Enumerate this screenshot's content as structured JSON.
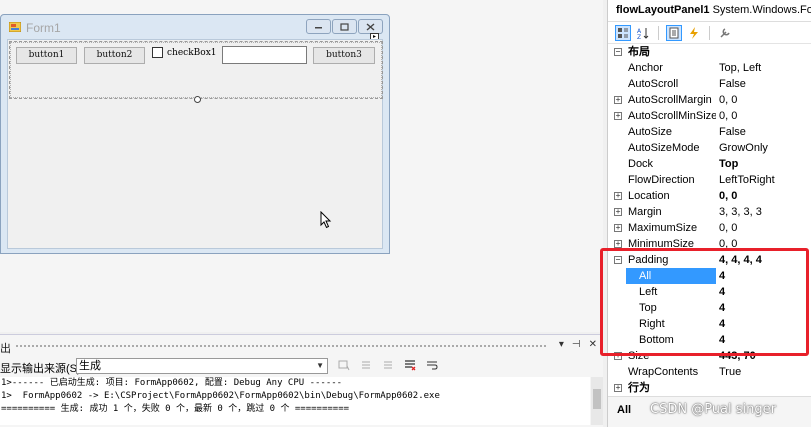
{
  "form": {
    "title": "Form1",
    "buttons": [
      "button1",
      "button2",
      "button3"
    ],
    "checkbox_label": "checkBox1",
    "textbox_value": "",
    "smart_tag": "▸"
  },
  "output": {
    "title": "出",
    "source_label": "显示输出来源(S):",
    "source_value": "生成",
    "lines": [
      "1>------ 已启动生成: 项目: FormApp0602, 配置: Debug Any CPU ------",
      "1>  FormApp0602 -> E:\\CSProject\\FormApp0602\\FormApp0602\\bin\\Debug\\FormApp0602.exe",
      "========== 生成: 成功 1 个，失败 0 个，最新 0 个，跳过 0 个 =========="
    ],
    "header_icons": [
      "▾",
      "⊣",
      "✕"
    ]
  },
  "properties": {
    "object_name": "flowLayoutPanel1",
    "object_type": "System.Windows.Fo",
    "rows": [
      {
        "kind": "category",
        "name": "布局",
        "expander": "⊟"
      },
      {
        "kind": "prop",
        "name": "Anchor",
        "value": "Top, Left"
      },
      {
        "kind": "prop",
        "name": "AutoScroll",
        "value": "False"
      },
      {
        "kind": "prop",
        "name": "AutoScrollMargin",
        "value": "0, 0",
        "expander": "⊞"
      },
      {
        "kind": "prop",
        "name": "AutoScrollMinSize",
        "value": "0, 0",
        "expander": "⊞"
      },
      {
        "kind": "prop",
        "name": "AutoSize",
        "value": "False"
      },
      {
        "kind": "prop",
        "name": "AutoSizeMode",
        "value": "GrowOnly"
      },
      {
        "kind": "prop",
        "name": "Dock",
        "value": "Top",
        "bold": true
      },
      {
        "kind": "prop",
        "name": "FlowDirection",
        "value": "LeftToRight"
      },
      {
        "kind": "prop",
        "name": "Location",
        "value": "0, 0",
        "expander": "⊞",
        "bold": true
      },
      {
        "kind": "prop",
        "name": "Margin",
        "value": "3, 3, 3, 3",
        "expander": "⊞"
      },
      {
        "kind": "prop",
        "name": "MaximumSize",
        "value": "0, 0",
        "expander": "⊞"
      },
      {
        "kind": "prop",
        "name": "MinimumSize",
        "value": "0, 0",
        "expander": "⊞"
      },
      {
        "kind": "prop",
        "name": "Padding",
        "value": "4, 4, 4, 4",
        "expander": "⊟",
        "bold": true
      },
      {
        "kind": "sub",
        "name": "All",
        "value": "4",
        "bold": true,
        "selected": true
      },
      {
        "kind": "sub",
        "name": "Left",
        "value": "4",
        "bold": true
      },
      {
        "kind": "sub",
        "name": "Top",
        "value": "4",
        "bold": true
      },
      {
        "kind": "sub",
        "name": "Right",
        "value": "4",
        "bold": true
      },
      {
        "kind": "sub",
        "name": "Bottom",
        "value": "4",
        "bold": true
      },
      {
        "kind": "prop",
        "name": "Size",
        "value": "443, 70",
        "expander": "⊞",
        "bold": true
      },
      {
        "kind": "prop",
        "name": "WrapContents",
        "value": "True"
      },
      {
        "kind": "category",
        "name": "行为",
        "expander": "⊞"
      }
    ],
    "description_title": "All"
  },
  "watermark": "CSDN @Pual singer",
  "colors": {
    "highlight": "#e8202a",
    "selection": "#3399ff"
  }
}
